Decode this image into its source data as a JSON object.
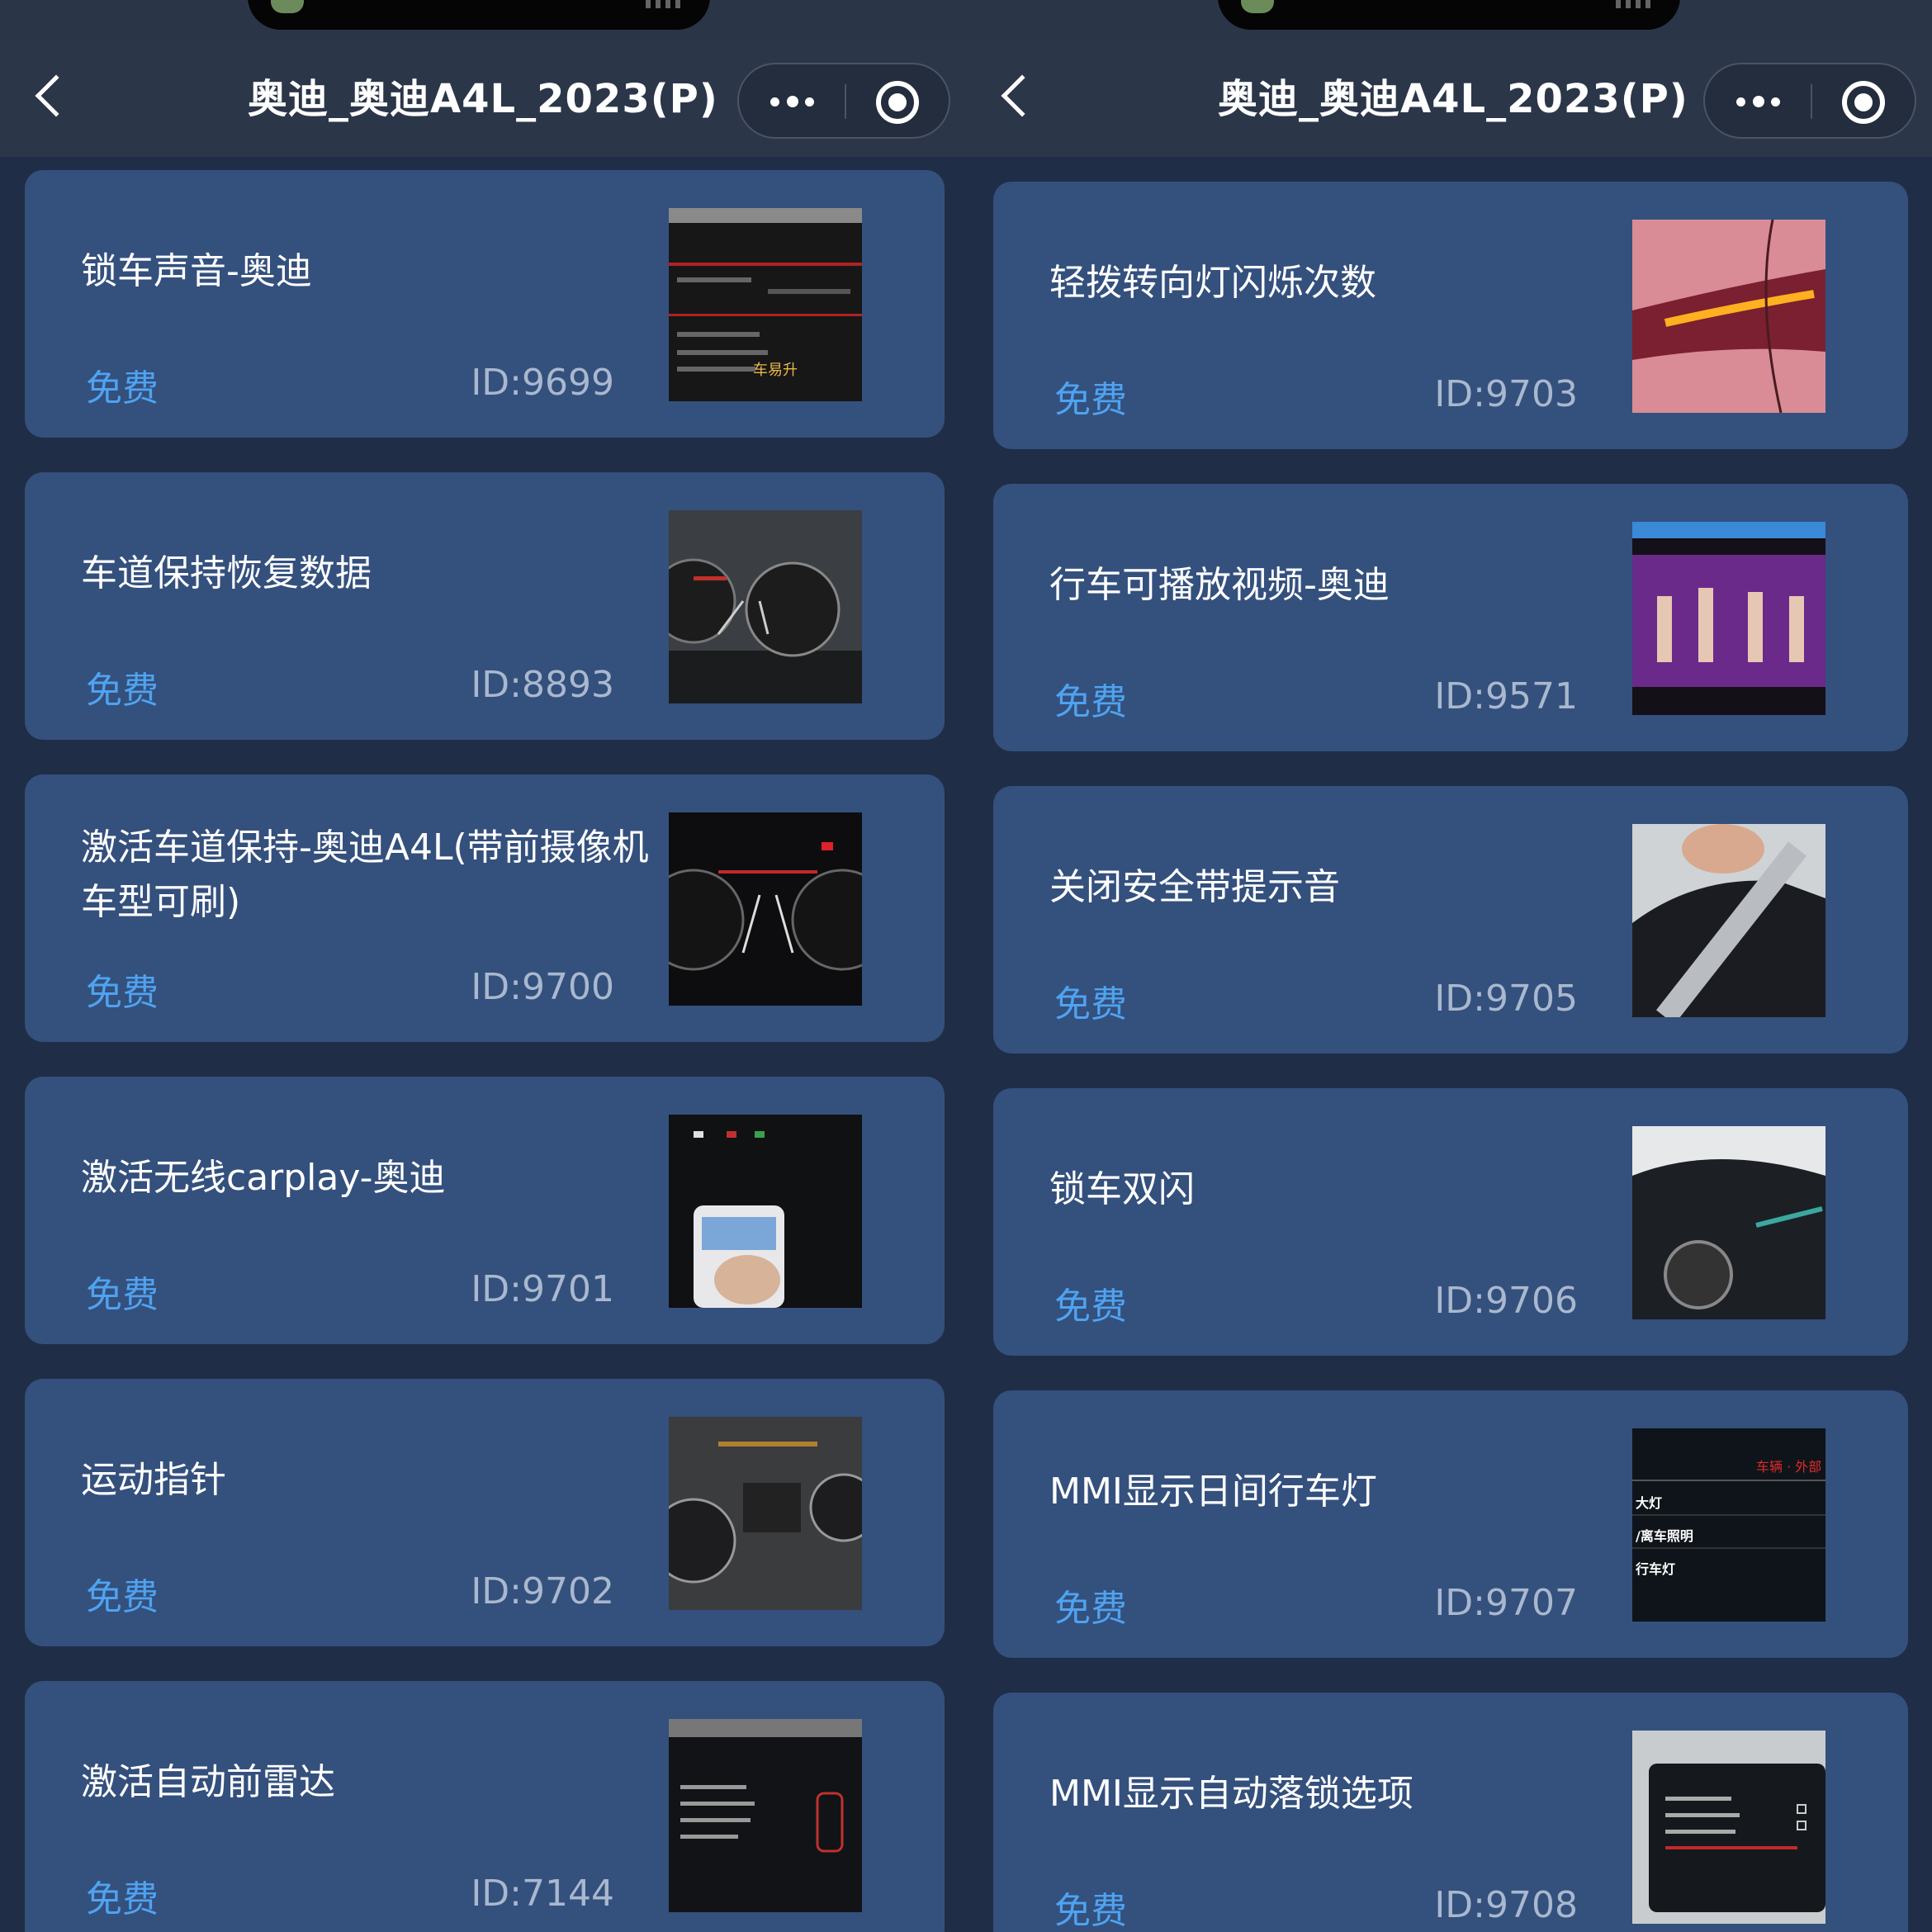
{
  "screens": [
    {
      "nav": {
        "title": "奥迪_奥迪A4L_2023(P)"
      },
      "items": [
        {
          "title": "锁车声音-奥迪",
          "price": "免费",
          "id": "ID:9699",
          "thumb_text": "车易升"
        },
        {
          "title": "车道保持恢复数据",
          "price": "免费",
          "id": "ID:8893"
        },
        {
          "title": "激活车道保持-奥迪A4L(带前摄像机车型可刷)",
          "price": "免费",
          "id": "ID:9700"
        },
        {
          "title": "激活无线carplay-奥迪",
          "price": "免费",
          "id": "ID:9701"
        },
        {
          "title": "运动指针",
          "price": "免费",
          "id": "ID:9702"
        },
        {
          "title": "激活自动前雷达",
          "price": "免费",
          "id": "ID:7144"
        }
      ]
    },
    {
      "nav": {
        "title": "奥迪_奥迪A4L_2023(P)"
      },
      "items": [
        {
          "title": "轻拨转向灯闪烁次数",
          "price": "免费",
          "id": "ID:9703"
        },
        {
          "title": "行车可播放视频-奥迪",
          "price": "免费",
          "id": "ID:9571"
        },
        {
          "title": "关闭安全带提示音",
          "price": "免费",
          "id": "ID:9705"
        },
        {
          "title": "锁车双闪",
          "price": "免费",
          "id": "ID:9706"
        },
        {
          "title": "MMI显示日间行车灯",
          "price": "免费",
          "id": "ID:9707",
          "thumb_lines": [
            "车辆 · 外部",
            "大灯",
            "/离车照明",
            "行车灯"
          ]
        },
        {
          "title": "MMI显示自动落锁选项",
          "price": "免费",
          "id": "ID:9708"
        }
      ]
    }
  ]
}
